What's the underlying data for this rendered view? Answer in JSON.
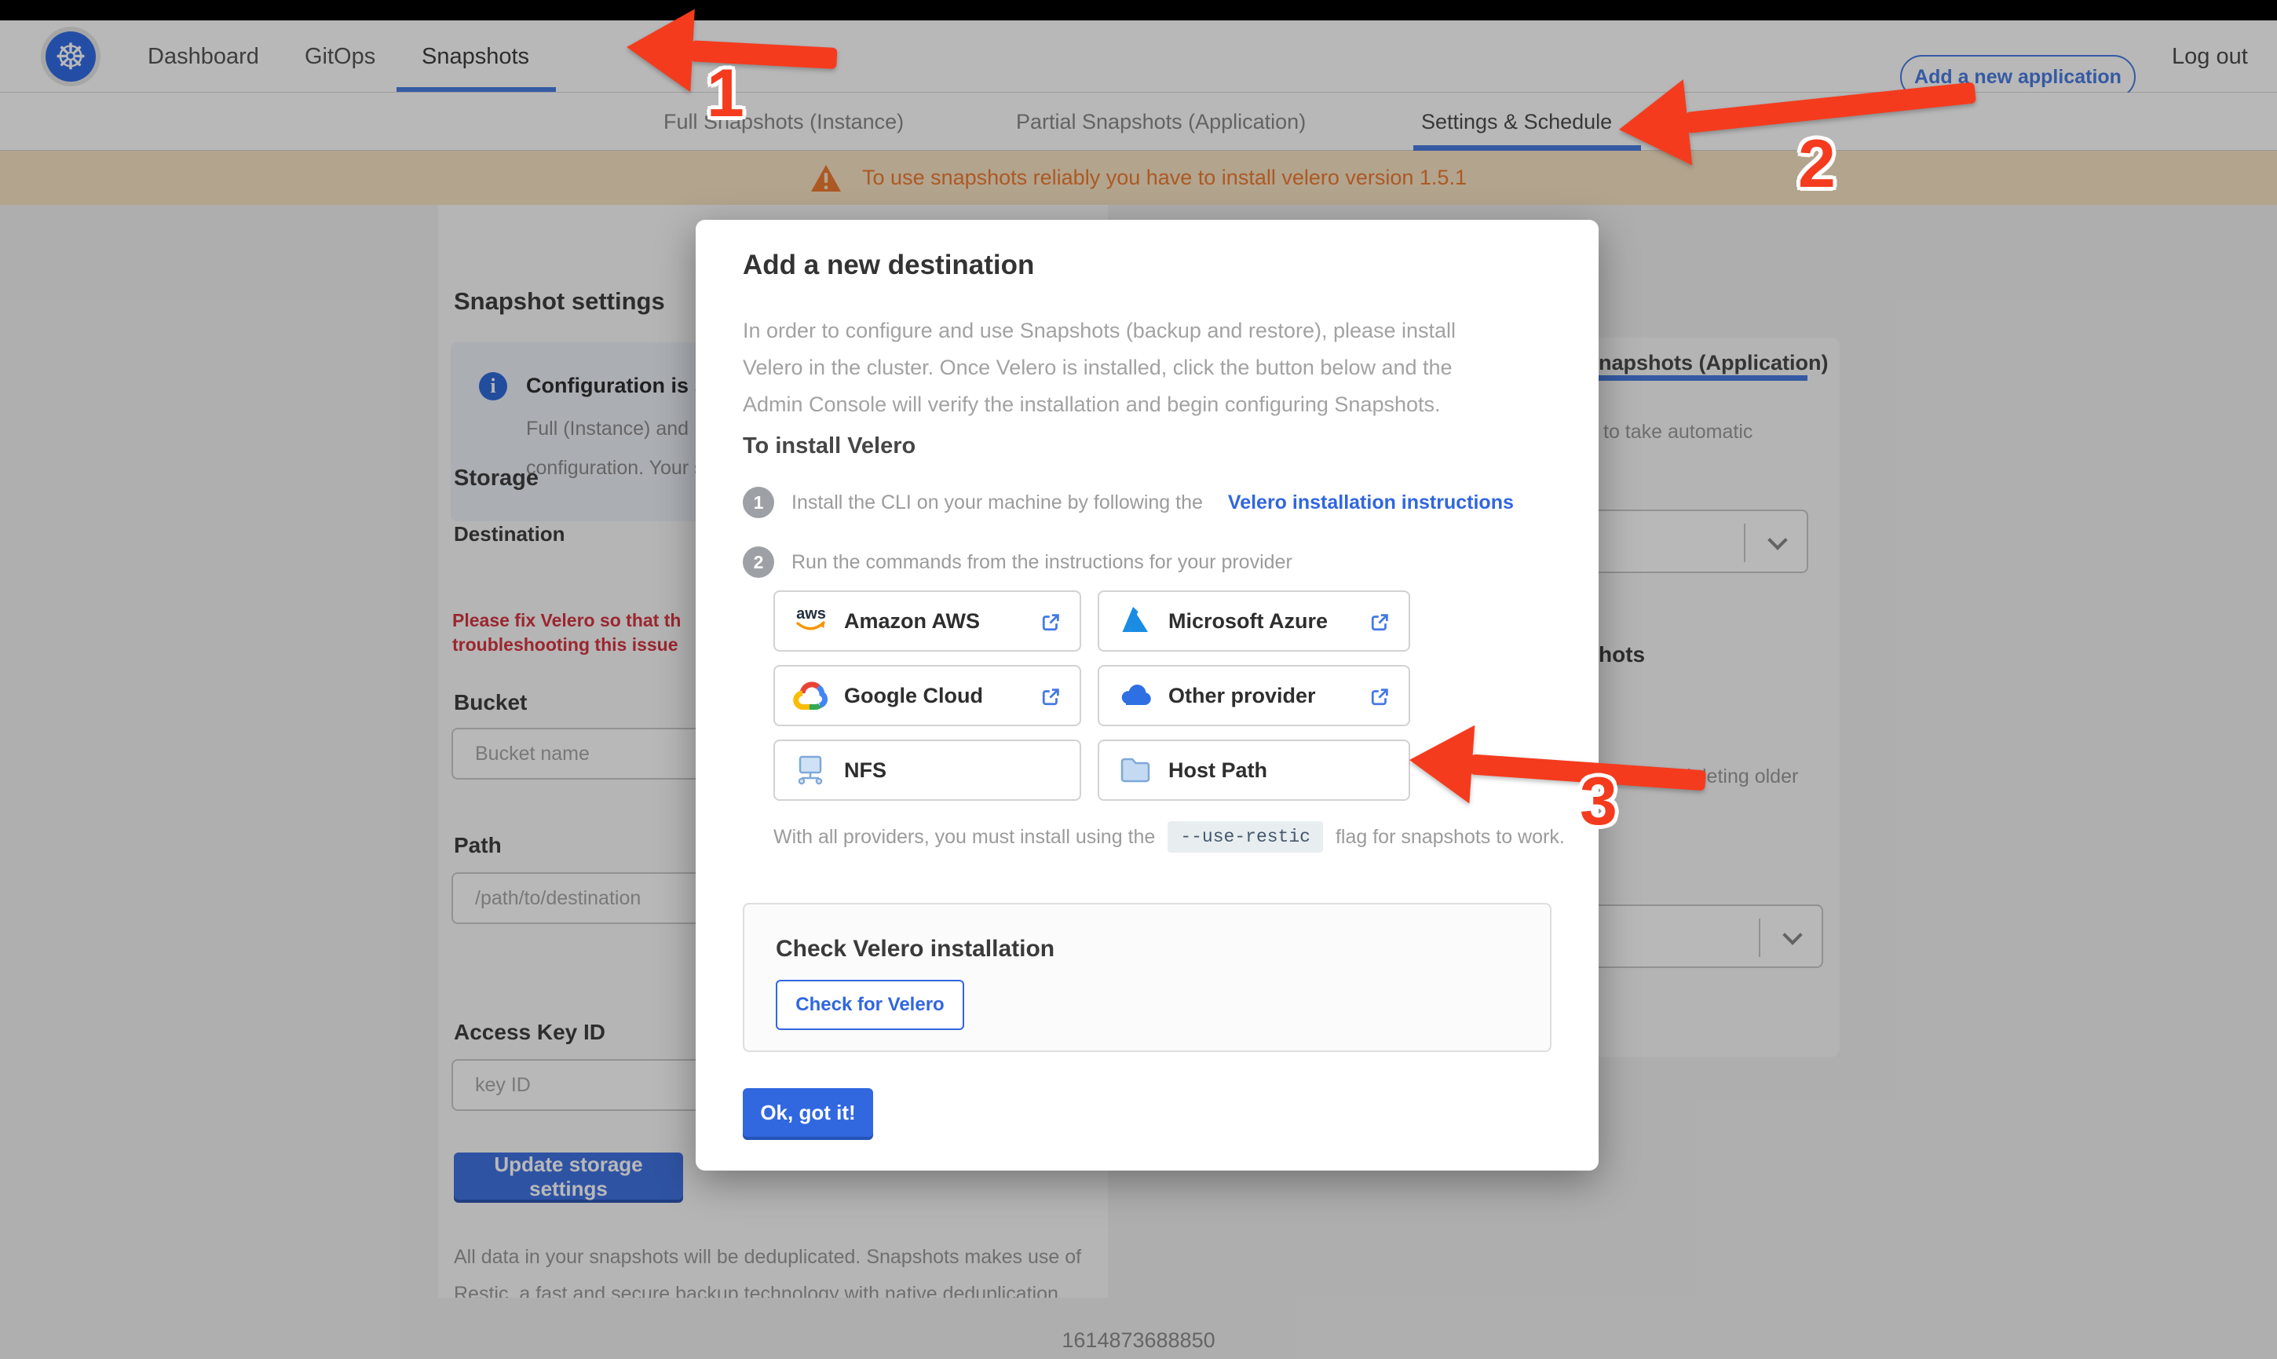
{
  "colors": {
    "accent_blue": "#3066e0",
    "nav_blue": "#4a7de2",
    "arrow_red": "#f43b1e",
    "banner_bg": "#f8e3c4",
    "banner_text": "#ef7c33",
    "error_red": "#d73543"
  },
  "topnav": {
    "logo_icon": "kubernetes-logo",
    "items": [
      "Dashboard",
      "GitOps",
      "Snapshots"
    ],
    "active_item": "Snapshots",
    "add_application_label": "Add a new application",
    "logout_label": "Log out"
  },
  "subnav": {
    "tabs": [
      "Full Snapshots (Instance)",
      "Partial Snapshots (Application)",
      "Settings & Schedule"
    ],
    "active_tab": "Settings & Schedule"
  },
  "banner": {
    "warning_icon": "warning-triangle-icon",
    "text": "To use snapshots reliably you have to install velero version 1.5.1"
  },
  "page": {
    "title": "Snapshot settings",
    "info_card": {
      "title_fragment": "Configuration is sh",
      "body_line1_fragment": "Full (Instance) and Parti",
      "body_line2_fragment": "configuration. Your stor"
    },
    "storage": {
      "heading": "Storage",
      "destination_label": "Destination",
      "error_line1_fragment": "Please fix Velero so that th",
      "error_line2_fragment": "troubleshooting this issue",
      "bucket_label": "Bucket",
      "bucket_placeholder": "Bucket name",
      "path_label": "Path",
      "path_placeholder": "/path/to/destination",
      "access_key_label": "Access Key ID",
      "access_key_placeholder": "key ID",
      "update_button_label": "Update storage settings",
      "footnote_line1": "All data in your snapshots will be deduplicated. Snapshots makes use of",
      "footnote_line2": "Restic, a fast and secure backup technology with native deduplication."
    },
    "schedule": {
      "tab_fragment": "napshots (Application)",
      "caption_fragment": "to take automatic",
      "retention_heading_fragment": "hots",
      "retention_caption_fragment": "matically deleting older"
    }
  },
  "modal": {
    "title": "Add a new destination",
    "intro_line1": "In order to configure and use Snapshots (backup and restore), please install",
    "intro_line2": "Velero in the cluster. Once Velero is installed, click the button below and the",
    "intro_line3": "Admin Console will verify the installation and begin configuring Snapshots.",
    "install_heading": "To install Velero",
    "steps": [
      {
        "number": "1",
        "text": "Install the CLI on your machine by following the",
        "link": "Velero installation instructions"
      },
      {
        "number": "2",
        "text": "Run the commands from the instructions for your provider",
        "link": ""
      }
    ],
    "providers": [
      {
        "label": "Amazon AWS",
        "icon": "aws-logo"
      },
      {
        "label": "Microsoft Azure",
        "icon": "azure-logo"
      },
      {
        "label": "Google Cloud",
        "icon": "google-cloud-logo"
      },
      {
        "label": "Other provider",
        "icon": "cloud-icon"
      },
      {
        "label": "NFS",
        "icon": "nfs-network-folder-icon"
      },
      {
        "label": "Host Path",
        "icon": "folder-icon"
      }
    ],
    "restic_note_prefix": "With all providers, you must install using the",
    "restic_flag": "--use-restic",
    "restic_note_suffix": "flag for snapshots to work.",
    "check_section": {
      "heading": "Check Velero installation",
      "button_label": "Check for Velero"
    },
    "ok_button_label": "Ok, got it!"
  },
  "annotations": {
    "arrow1_label": "1",
    "arrow2_label": "2",
    "arrow3_label": "3"
  },
  "footer": {
    "timestamp": "1614873688850"
  }
}
